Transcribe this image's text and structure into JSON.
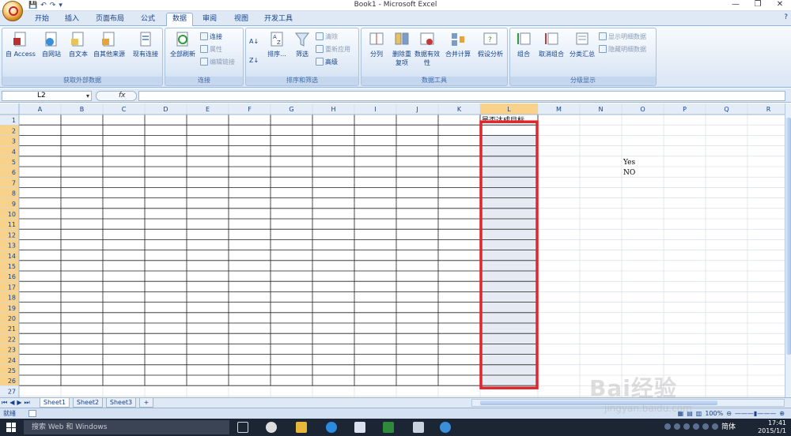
{
  "title": "Book1 - Microsoft Excel",
  "window_controls": {
    "minimize": "—",
    "restore": "❐",
    "close": "✕"
  },
  "qat": {
    "save": "💾",
    "undo": "↶",
    "redo": "↷",
    "more": "▾"
  },
  "tabs": [
    "开始",
    "插入",
    "页面布局",
    "公式",
    "数据",
    "审阅",
    "视图",
    "开发工具"
  ],
  "active_tab": "数据",
  "help": "?",
  "ribbon": {
    "get_external": {
      "label": "获取外部数据",
      "buttons": [
        "自 Access",
        "自网站",
        "自文本",
        "自其他来源",
        "现有连接"
      ]
    },
    "connections": {
      "label": "连接",
      "refresh": "全部刷新",
      "small": [
        "连接",
        "属性",
        "编辑链接"
      ]
    },
    "sort_filter": {
      "label": "排序和筛选",
      "sort": "排序...",
      "filter": "筛选",
      "small": [
        "清除",
        "重新应用",
        "高级"
      ]
    },
    "data_tools": {
      "label": "数据工具",
      "buttons": [
        "分列",
        "删除重复项",
        "数据有效性",
        "合并计算",
        "假设分析"
      ]
    },
    "outline": {
      "label": "分级显示",
      "buttons": [
        "组合",
        "取消组合",
        "分类汇总"
      ],
      "small": [
        "显示明细数据",
        "隐藏明细数据"
      ]
    }
  },
  "namebox": "L2",
  "fx": "fx",
  "columns": [
    "A",
    "B",
    "C",
    "D",
    "E",
    "F",
    "G",
    "H",
    "I",
    "J",
    "K",
    "L",
    "M",
    "N",
    "O",
    "P",
    "Q",
    "R"
  ],
  "rows": [
    "1",
    "2",
    "3",
    "4",
    "5",
    "6",
    "7",
    "8",
    "9",
    "10",
    "11",
    "12",
    "13",
    "14",
    "15",
    "16",
    "17",
    "18",
    "19",
    "20",
    "21",
    "22",
    "23",
    "24",
    "25",
    "26",
    "27"
  ],
  "cells": {
    "L1": "是否达成目标",
    "O5": "Yes",
    "O6": "NO"
  },
  "sheets": [
    "Sheet1",
    "Sheet2",
    "Sheet3"
  ],
  "status": "就绪",
  "zoom": "100%",
  "taskbar": {
    "search": "搜索 Web 和 Windows",
    "time": "17:41",
    "date": "2015/1/1",
    "lang": "简体"
  },
  "watermark": "Bai经验",
  "watermark_sub": "jingyan.baidu.com",
  "colors": {
    "highlight_border": "#e0252b",
    "selected_fill": "#e6eaf2"
  }
}
